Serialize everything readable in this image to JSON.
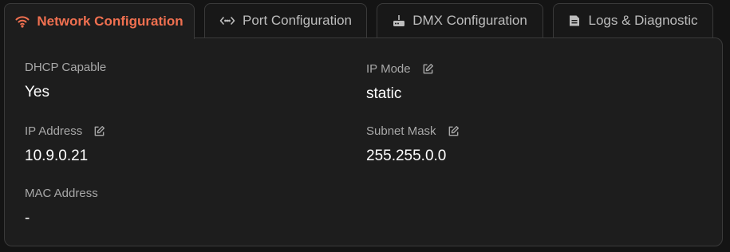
{
  "tabs": [
    {
      "label": "Network Configuration",
      "icon": "wifi-icon",
      "active": true
    },
    {
      "label": "Port Configuration",
      "icon": "code-arrows-icon",
      "active": false
    },
    {
      "label": "DMX Configuration",
      "icon": "router-icon",
      "active": false
    },
    {
      "label": "Logs & Diagnostic",
      "icon": "document-icon",
      "active": false
    }
  ],
  "fields": {
    "dhcp": {
      "label": "DHCP Capable",
      "value": "Yes",
      "editable": false
    },
    "ip_mode": {
      "label": "IP Mode",
      "value": "static",
      "editable": true
    },
    "ip_address": {
      "label": "IP Address",
      "value": "10.9.0.21",
      "editable": true
    },
    "subnet_mask": {
      "label": "Subnet Mask",
      "value": "255.255.0.0",
      "editable": true
    },
    "mac_address": {
      "label": "MAC Address",
      "value": "-",
      "editable": false
    }
  },
  "colors": {
    "accent": "#f07050",
    "background": "#141414",
    "panel": "#1d1d1d",
    "border": "#3a3a3a"
  }
}
